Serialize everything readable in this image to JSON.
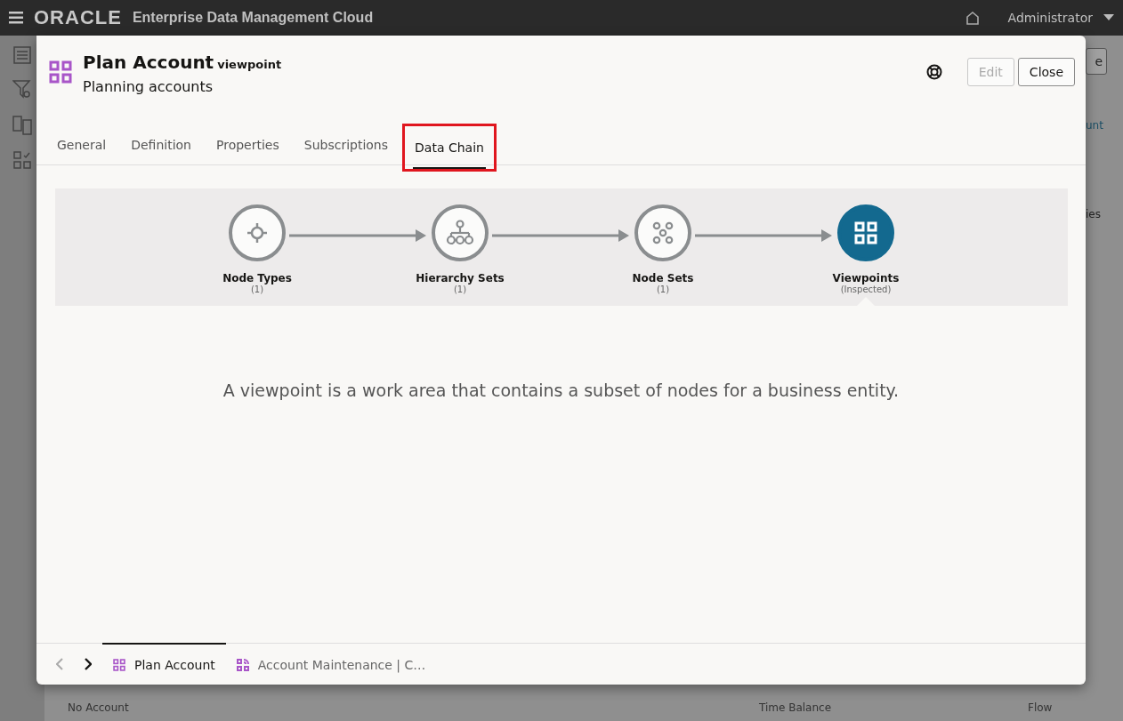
{
  "app_header": {
    "brand": "ORACLE",
    "product": "Enterprise Data Management Cloud",
    "user": "Administrator"
  },
  "background_page": {
    "button_fragment": "e",
    "link_fragment": "unt",
    "label_fragment": "ies",
    "row": {
      "column_1": "No Account",
      "column_2": "Time Balance",
      "column_3": "Flow"
    }
  },
  "dialog": {
    "title": "Plan Account",
    "type": "viewpoint",
    "subtitle": "Planning accounts",
    "buttons": [
      {
        "label": "Edit",
        "disabled": true
      },
      {
        "label": "Close",
        "disabled": false
      }
    ],
    "tabs": [
      {
        "label": "General",
        "selected": false,
        "highlighted": false
      },
      {
        "label": "Definition",
        "selected": false,
        "highlighted": false
      },
      {
        "label": "Properties",
        "selected": false,
        "highlighted": false
      },
      {
        "label": "Subscriptions",
        "selected": false,
        "highlighted": false
      },
      {
        "label": "Data Chain",
        "selected": true,
        "highlighted": true
      }
    ],
    "chain": [
      {
        "kind": "node_types",
        "label": "Node Types",
        "note": "(1)",
        "inspected": false
      },
      {
        "kind": "hierarchy_sets",
        "label": "Hierarchy Sets",
        "note": "(1)",
        "inspected": false
      },
      {
        "kind": "node_sets",
        "label": "Node Sets",
        "note": "(1)",
        "inspected": false
      },
      {
        "kind": "viewpoints",
        "label": "Viewpoints",
        "note": "(Inspected)",
        "inspected": true
      }
    ],
    "description": "A viewpoint is a work area that contains a subset of nodes for a business entity.",
    "bottom_nav": {
      "back_disabled": true,
      "forward_disabled": false
    },
    "bottom_tabs": [
      {
        "kind": "viewpoint",
        "label": "Plan Account",
        "selected": true
      },
      {
        "kind": "view",
        "label": "Account Maintenance | C…",
        "selected": false
      }
    ]
  }
}
